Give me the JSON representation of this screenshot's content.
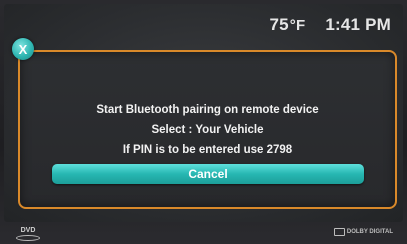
{
  "status_bar": {
    "temperature": "75",
    "temperature_unit": "°F",
    "time": "1:41 PM"
  },
  "dialog": {
    "close_label": "X",
    "message_lines": [
      "Start Bluetooth pairing on remote device",
      "Select : Your Vehicle",
      "If PIN is to be entered use 2798"
    ],
    "cancel_label": "Cancel"
  },
  "footer": {
    "left_logo": "DVD",
    "right_logo": "DOLBY DIGITAL"
  },
  "colors": {
    "dialog_border": "#d9892a",
    "accent": "#2fb6b2"
  },
  "icons": {
    "close": "close-icon",
    "dvd": "dvd-logo-icon",
    "dolby": "dolby-digital-logo-icon"
  }
}
